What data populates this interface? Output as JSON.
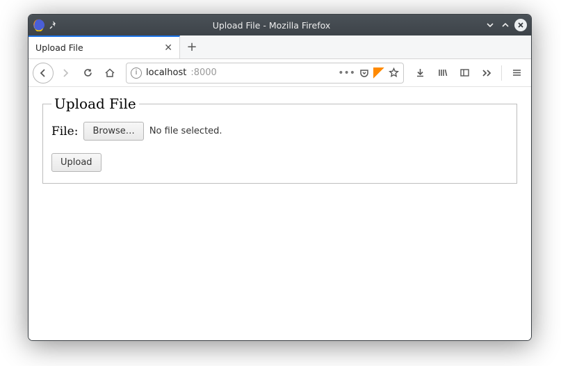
{
  "window": {
    "title": "Upload File - Mozilla Firefox"
  },
  "tab": {
    "title": "Upload File"
  },
  "url": {
    "host": "localhost",
    "port": ":8000"
  },
  "page": {
    "legend": "Upload File",
    "file_label": "File:",
    "browse_label": "Browse…",
    "file_status": "No file selected.",
    "submit_label": "Upload"
  }
}
